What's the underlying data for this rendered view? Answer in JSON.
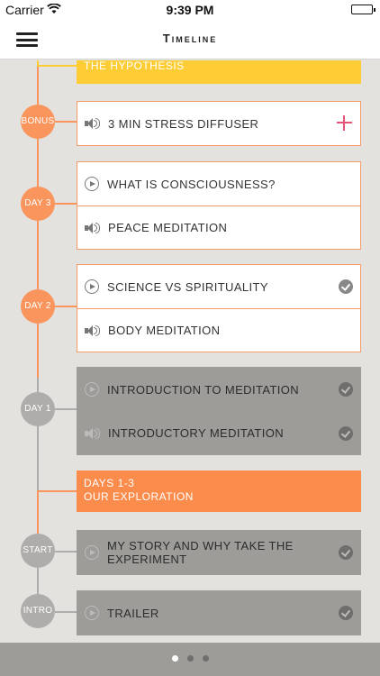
{
  "status_bar": {
    "carrier": "Carrier",
    "time": "9:39 PM"
  },
  "header": {
    "title": "Timeline"
  },
  "timeline": {
    "top_banner": {
      "text": "THE HYPOTHESIS"
    },
    "bonus": {
      "node_label": "BONUS",
      "items": [
        {
          "label": "3 MIN STRESS DIFFUSER",
          "icon": "speaker-icon",
          "action": "plus-icon"
        }
      ]
    },
    "day3": {
      "node_label": "DAY 3",
      "items": [
        {
          "label": "WHAT IS CONSCIOUSNESS?",
          "icon": "play-icon"
        },
        {
          "label": "PEACE MEDITATION",
          "icon": "speaker-icon"
        }
      ]
    },
    "day2": {
      "node_label": "DAY 2",
      "items": [
        {
          "label": "SCIENCE VS SPIRITUALITY",
          "icon": "play-icon",
          "completed": true
        },
        {
          "label": "BODY MEDITATION",
          "icon": "speaker-icon"
        }
      ]
    },
    "day1": {
      "node_label": "DAY 1",
      "items": [
        {
          "label": "INTRODUCTION TO MEDITATION",
          "icon": "play-icon",
          "completed": true
        },
        {
          "label": "INTRODUCTORY MEDITATION",
          "icon": "speaker-icon",
          "completed": true
        }
      ]
    },
    "section_banner": {
      "line1": "DAYS 1-3",
      "line2": "OUR EXPLORATION"
    },
    "start": {
      "node_label": "START",
      "items": [
        {
          "label_line1": "MY STORY AND WHY TAKE THE",
          "label_line2": "EXPERIMENT",
          "icon": "play-icon",
          "completed": true
        }
      ]
    },
    "intro": {
      "node_label": "INTRO",
      "items": [
        {
          "label": "TRAILER",
          "icon": "play-icon",
          "completed": true
        }
      ]
    }
  },
  "page_indicator": {
    "pages": 3,
    "current": 1
  },
  "colors": {
    "orange": "#f9955d",
    "yellow": "#fecd35",
    "grey_card": "#9d9c99",
    "accent_plus": "#e85478",
    "background": "#e3e2de"
  }
}
